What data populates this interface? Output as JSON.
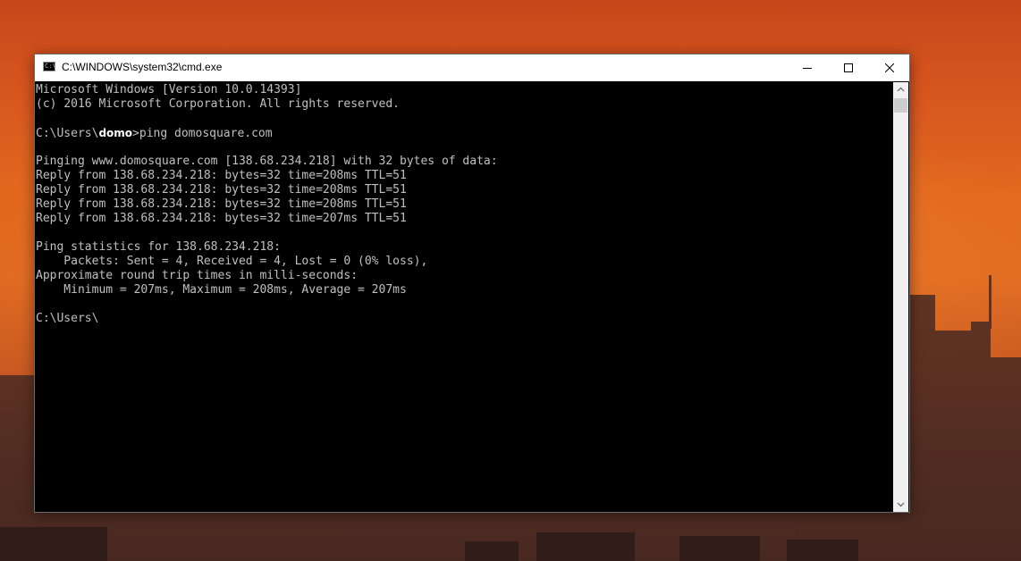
{
  "window": {
    "title": "C:\\WINDOWS\\system32\\cmd.exe",
    "icon": "cmd-icon",
    "icon_text": "C:\\"
  },
  "console": {
    "lines": [
      "Microsoft Windows [Version 10.0.14393]",
      "(c) 2016 Microsoft Corporation. All rights reserved.",
      "",
      "",
      "",
      "Pinging www.domosquare.com [138.68.234.218] with 32 bytes of data:",
      "Reply from 138.68.234.218: bytes=32 time=208ms TTL=51",
      "Reply from 138.68.234.218: bytes=32 time=208ms TTL=51",
      "Reply from 138.68.234.218: bytes=32 time=208ms TTL=51",
      "Reply from 138.68.234.218: bytes=32 time=207ms TTL=51",
      "",
      "Ping statistics for 138.68.234.218:",
      "    Packets: Sent = 4, Received = 4, Lost = 0 (0% loss),",
      "Approximate round trip times in milli-seconds:",
      "    Minimum = 207ms, Maximum = 208ms, Average = 207ms",
      ""
    ],
    "prompt_prefix": "C:\\Users\\",
    "username": "domo",
    "command_prompt_char": ">",
    "command": "ping domosquare.com",
    "final_prompt_prefix": "C:\\Users\\"
  },
  "controls": {
    "minimize": "minimize-icon",
    "maximize": "maximize-icon",
    "close": "close-icon"
  },
  "colors": {
    "console_bg": "#000000",
    "console_text": "#c0c0c0",
    "titlebar_bg": "#ffffff"
  }
}
